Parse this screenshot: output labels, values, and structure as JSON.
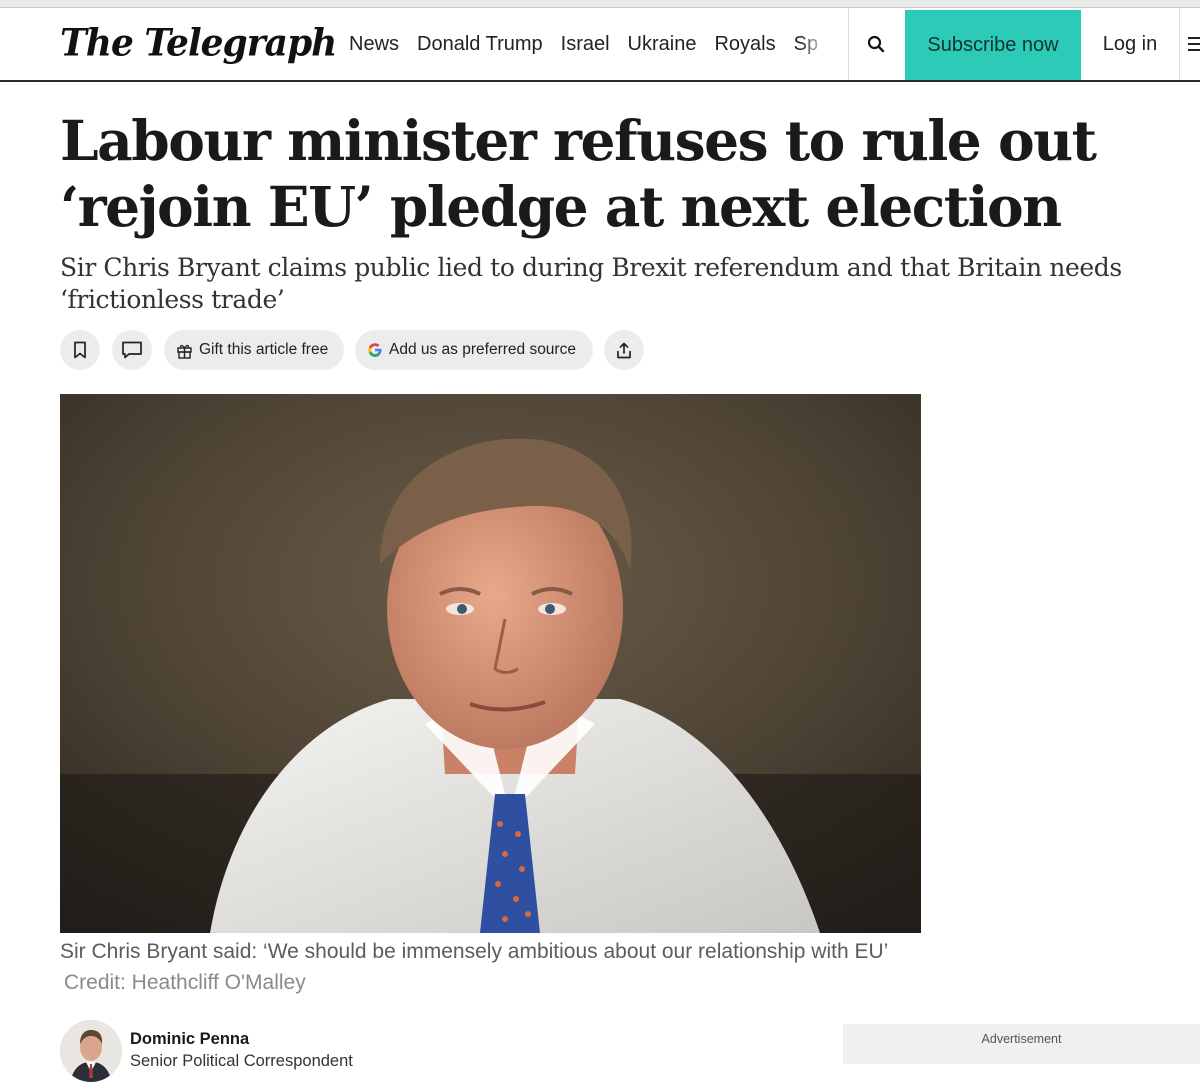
{
  "header": {
    "logo": "The Telegraph",
    "nav": [
      "News",
      "Donald Trump",
      "Israel",
      "Ukraine",
      "Royals",
      "Sp"
    ],
    "subscribe_label": "Subscribe now",
    "login_label": "Log in",
    "brand_accent": "#2ccbb8"
  },
  "article": {
    "headline": "Labour minister refuses to rule out ‘rejoin EU’ pledge at next election",
    "standfirst": "Sir Chris Bryant claims public lied to during Brexit referendum and that Britain needs ‘frictionless trade’",
    "actions": {
      "bookmark_icon": "bookmark-icon",
      "comment_icon": "comment-icon",
      "gift_label": "Gift this article free",
      "preferred_source_label": "Add us as preferred source",
      "share_icon": "share-icon"
    },
    "caption": "Sir Chris Bryant said: ‘We should be immensely ambitious about our relationship with EU’",
    "credit": "Credit: Heathcliff O'Malley"
  },
  "author": {
    "name": "Dominic Penna",
    "role": "Senior Political Correspondent"
  },
  "advert": {
    "label": "Advertisement"
  }
}
